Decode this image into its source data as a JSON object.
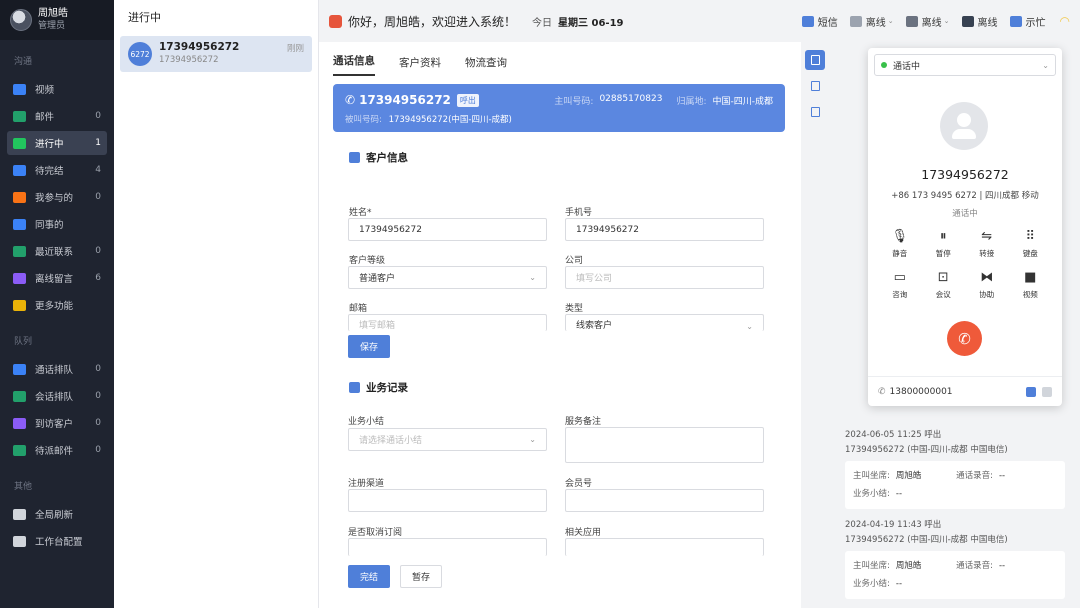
{
  "user": {
    "name": "周旭皓",
    "role": "管理员"
  },
  "nav": {
    "sections": [
      {
        "title": "沟通",
        "items": [
          {
            "label": "视频",
            "count": "",
            "color": "#3b82f6"
          },
          {
            "label": "邮件",
            "count": "0",
            "color": "#22a06b"
          },
          {
            "label": "进行中",
            "count": "1",
            "color": "#22c55e",
            "active": true
          },
          {
            "label": "待完结",
            "count": "4",
            "color": "#3b82f6"
          },
          {
            "label": "我参与的",
            "count": "0",
            "color": "#f97316"
          },
          {
            "label": "同事的",
            "count": "",
            "color": "#3b82f6"
          },
          {
            "label": "最近联系",
            "count": "0",
            "color": "#22a06b"
          },
          {
            "label": "离线留言",
            "count": "6",
            "color": "#8b5cf6"
          },
          {
            "label": "更多功能",
            "count": "",
            "color": "#eab308"
          }
        ]
      },
      {
        "title": "队列",
        "items": [
          {
            "label": "通话排队",
            "count": "0",
            "color": "#3b82f6"
          },
          {
            "label": "会话排队",
            "count": "0",
            "color": "#22a06b"
          },
          {
            "label": "到访客户",
            "count": "0",
            "color": "#8b5cf6"
          },
          {
            "label": "待派邮件",
            "count": "0",
            "color": "#22a06b"
          }
        ]
      },
      {
        "title": "其他",
        "items": [
          {
            "label": "全局刷新",
            "count": "",
            "color": "#d1d5db"
          },
          {
            "label": "工作台配置",
            "count": "",
            "color": "#d1d5db"
          }
        ]
      }
    ]
  },
  "session_list": {
    "title": "进行中",
    "card": {
      "badge": "6272",
      "number": "17394956272",
      "sub": "17394956272",
      "time": "刚刚"
    }
  },
  "topbar": {
    "greeting": "你好，周旭皓，欢迎进入系统！",
    "today_label": "今日",
    "today_value": "星期三 06-19",
    "actions": [
      {
        "label": "短信",
        "color": "#4f7fd9",
        "chevron": false
      },
      {
        "label": "离线",
        "color": "#9ca3af",
        "chevron": true
      },
      {
        "label": "离线",
        "color": "#6b7280",
        "chevron": true
      },
      {
        "label": "离线",
        "color": "#374151",
        "chevron": false
      },
      {
        "label": "示忙",
        "color": "#4f7fd9",
        "chevron": false
      }
    ]
  },
  "main": {
    "tabs": [
      "通话信息",
      "客户资料",
      "物流查询"
    ],
    "banner": {
      "number": "17394956272",
      "tag": "呼出",
      "caller_label": "主叫号码:",
      "caller_value": "02885170823",
      "location_label": "归属地:",
      "location_value": "中国-四川-成都",
      "called_label": "被叫号码:",
      "called_value": "17394956272(中国-四川-成都)"
    },
    "customer": {
      "title": "客户信息",
      "name_label": "姓名*",
      "name_value": "17394956272",
      "phone_label": "手机号",
      "phone_value": "17394956272",
      "level_label": "客户等级",
      "level_value": "普通客户",
      "company_label": "公司",
      "company_placeholder": "填写公司",
      "email_label": "邮箱",
      "email_placeholder": "填写邮箱",
      "type_label": "类型",
      "type_value": "线索客户",
      "save": "保存"
    },
    "business": {
      "title": "业务记录",
      "summary_label": "业务小结",
      "summary_placeholder": "请选择通话小结",
      "note_label": "服务备注",
      "channel_label": "注册渠道",
      "member_label": "会员号",
      "unsubscribe_label": "是否取消订阅",
      "app_label": "相关应用",
      "finish": "完结",
      "pause": "暂存"
    }
  },
  "history": {
    "entries": [
      {
        "date": "2024-06-05 11:25 呼出",
        "number": "17394956272 (中国-四川-成都 中国电信)",
        "agent_label": "主叫坐席:",
        "agent": "周旭皓",
        "record_label": "通话录音:",
        "record": "--",
        "summary_label": "业务小结:",
        "summary": "--"
      },
      {
        "date": "2024-04-19 11:43 呼出",
        "number": "17394956272 (中国-四川-成都 中国电信)",
        "agent_label": "主叫坐席:",
        "agent": "周旭皓",
        "record_label": "通话录音:",
        "record": "--",
        "summary_label": "业务小结:",
        "summary": "--"
      }
    ]
  },
  "softphone": {
    "status": "通话中",
    "number": "17394956272",
    "detail": "+86 173 9495 6272 | 四川成都 移动",
    "state": "通话中",
    "keys": [
      {
        "label": "静音",
        "icon": "mic-icon",
        "glyph": "🎙"
      },
      {
        "label": "暂停",
        "icon": "pause-icon",
        "glyph": "⏸"
      },
      {
        "label": "转接",
        "icon": "transfer-icon",
        "glyph": "⇋"
      },
      {
        "label": "键盘",
        "icon": "keypad-icon",
        "glyph": "⠿"
      },
      {
        "label": "咨询",
        "icon": "consult-icon",
        "glyph": "▭"
      },
      {
        "label": "会议",
        "icon": "meeting-icon",
        "glyph": "⊡"
      },
      {
        "label": "协助",
        "icon": "assist-icon",
        "glyph": "⧓"
      },
      {
        "label": "视频",
        "icon": "video-icon",
        "glyph": "■"
      }
    ],
    "footer_number": "13800000001"
  }
}
